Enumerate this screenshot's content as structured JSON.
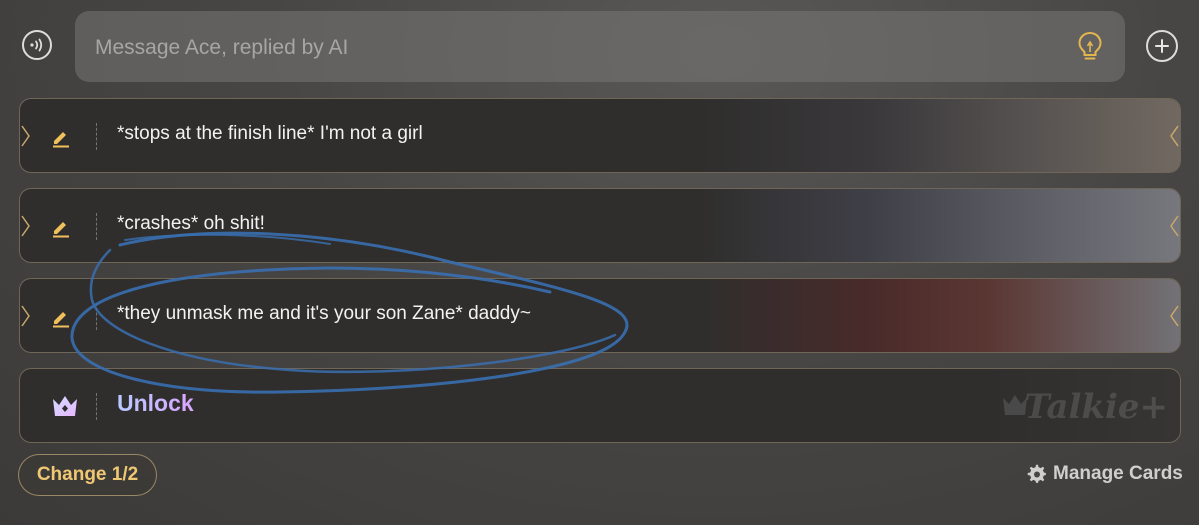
{
  "composer": {
    "placeholder": "Message Ace, replied by AI",
    "voice_icon": "voice-wave-icon",
    "hint_icon": "lightbulb-icon",
    "add_icon": "plus-circle-icon"
  },
  "suggestions": [
    {
      "text": "*stops at the finish line* I'm not a girl",
      "icon": "pencil-icon"
    },
    {
      "text": "*crashes* oh shit!",
      "icon": "pencil-icon"
    },
    {
      "text": "*they unmask me and it's your son Zane* daddy~",
      "icon": "pencil-icon"
    }
  ],
  "unlock_card": {
    "label": "Unlock",
    "icon": "crown-icon",
    "brand_watermark": "Talkie",
    "brand_suffix": "+"
  },
  "footer": {
    "change_label": "Change 1/2",
    "manage_label": "Manage Cards",
    "manage_icon": "gear-icon"
  },
  "colors": {
    "accent_gold": "#f0c874",
    "unlock_gradient_start": "#b9c9ff",
    "unlock_gradient_end": "#d9a6ff",
    "annotation_blue": "#3a6fb0"
  }
}
